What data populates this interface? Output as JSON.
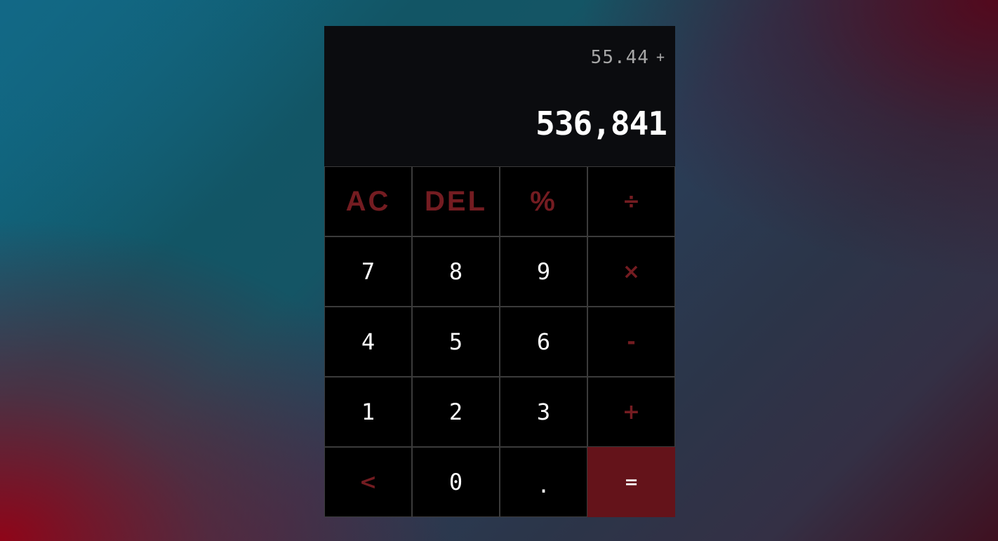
{
  "display": {
    "previous_value": "55.44",
    "previous_operator": "+",
    "current_value": "536,841"
  },
  "keys": {
    "row1": [
      "AC",
      "DEL",
      "%",
      "÷"
    ],
    "row2": [
      "7",
      "8",
      "9",
      "×"
    ],
    "row3": [
      "4",
      "5",
      "6",
      "-"
    ],
    "row4": [
      "1",
      "2",
      "3",
      "+"
    ],
    "row5": [
      "<",
      "0",
      ".",
      "="
    ]
  },
  "colors": {
    "accent": "#741c21",
    "equals_bg": "#64131a",
    "display_bg": "#0b0c0f",
    "key_bg": "#000000",
    "key_border": "#3b3b3b"
  }
}
